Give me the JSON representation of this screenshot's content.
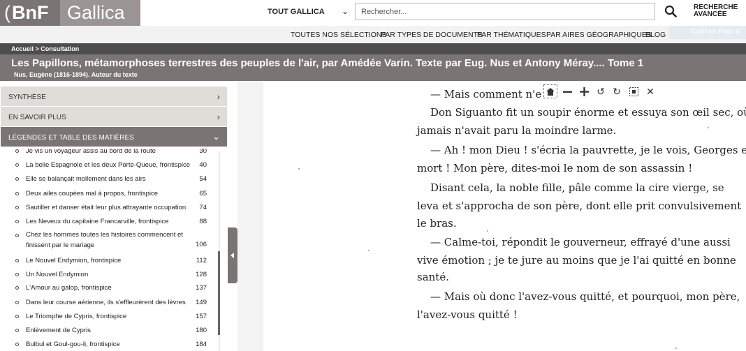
{
  "header": {
    "logo_brace": "(",
    "logo_text": "BnF",
    "site_name": "Gallica",
    "scope": "TOUT GALLICA",
    "search_placeholder": "Rechercher...",
    "advanced_line1": "RECHERCHE",
    "advanced_line2": "AVANCÉE"
  },
  "nav": {
    "items": [
      "TOUTES NOS SÉLECTIONS",
      "PAR TYPES DE DOCUMENTS",
      "PAR THÉMATIQUES",
      "PAR AIRES GÉOGRAPHIQUES",
      "BLOG"
    ],
    "capture": "Capture Plein é"
  },
  "breadcrumb": "Accueil  >  Consultation",
  "document": {
    "title": "Les Papillons, métamorphoses terrestres des peuples de l'air, par Amédée Varin. Texte par Eug. Nus et Antony Méray.... Tome 1",
    "author": "Nus, Eugène (1816-1894). Auteur du texte"
  },
  "sidebar": {
    "sections": [
      "SYNTHÈSE",
      "EN SAVOIR PLUS",
      "LÉGENDES ET TABLE DES MATIÈRES"
    ],
    "toc": [
      {
        "label": "Je vis un voyageur assis au bord de la route",
        "page": "30"
      },
      {
        "label": "La belle Espagnole et les deux Porte-Queue, frontispice",
        "page": "40"
      },
      {
        "label": "Elle se balançait mollement dans les airs",
        "page": "54"
      },
      {
        "label": "Deux ailes coupées mal à propos, frontispice",
        "page": "65"
      },
      {
        "label": "Sautiller et danser était leur plus attrayante occupation",
        "page": "74"
      },
      {
        "label": "Les Neveux du capitaine Francarville, frontispice",
        "page": "88"
      },
      {
        "label": "Chez les hommes toutes les histoires commencent et finissent par le mariage",
        "page": "106"
      },
      {
        "label": "Le Nouvel Endymion, frontispice",
        "page": "112"
      },
      {
        "label": "Un Nouvel Endymion",
        "page": "128"
      },
      {
        "label": "L'Amour au galop, frontispice",
        "page": "137"
      },
      {
        "label": "Dans leur course aérienne, ils s'effleurèrent des lèvres",
        "page": "149"
      },
      {
        "label": "Le Triomphe de Cypris, frontispice",
        "page": "157"
      },
      {
        "label": "Enlèvement de Cypris",
        "page": "180"
      },
      {
        "label": "Bulbul et Goul-gou-li, frontispice",
        "page": "184"
      }
    ]
  },
  "page_text": [
    "— Mais comment n'est-il plu",
    "Don Siguanto fit un soupir énorme et essuya son œil sec, où",
    "jamais n'avait paru la moindre larme.",
    "— Ah ! mon Dieu ! s'écria la pauvrette, je le vois, Georges est",
    "mort ! Mon père, dites-moi le nom de son assassin !",
    "Disant cela, la noble fille, pâle comme la cire vierge, se",
    "leva et s'approcha de son père, dont elle prit convulsivement",
    "le bras.",
    "— Calme-toi, répondit le gouverneur, effrayé d'une aussi",
    "vive émotion ; je te jure au moins que je l'ai quitté en bonne",
    "santé.",
    "— Mais où donc l'avez-vous quitté, et pourquoi, mon père,",
    "l'avez-vous quitté !"
  ],
  "toolbar": {
    "icons": [
      "home-icon",
      "zoom-out-icon",
      "zoom-in-icon",
      "rotate-left-icon",
      "rotate-right-icon",
      "fullscreen-icon",
      "close-icon"
    ]
  }
}
